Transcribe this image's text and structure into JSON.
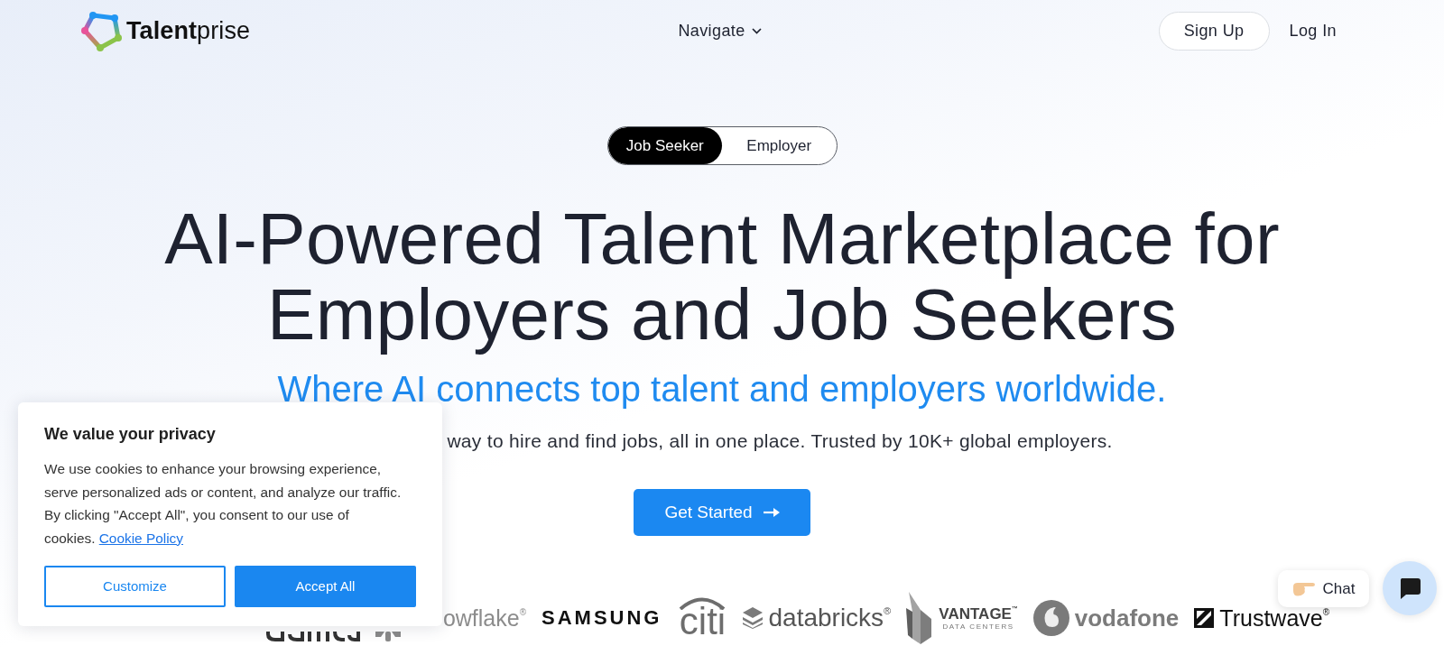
{
  "header": {
    "logo": {
      "text": "**Talent**prise"
    },
    "nav": [
      {
        "label": "Navigate",
        "kind": "dropdown"
      }
    ],
    "actions": [
      {
        "label": "Sign Up",
        "kind": "outline"
      },
      {
        "label": "Log In",
        "kind": "text"
      }
    ]
  },
  "audience_toggle": [
    {
      "label": "Job Seeker",
      "selected": true
    },
    {
      "label": "Employer",
      "selected": false
    }
  ],
  "hero": {
    "title": "AI-Powered Talent Marketplace for Employers and Job Seekers",
    "subtitle": "Where AI connects top talent and employers worldwide.",
    "description": "way to hire and find jobs, all in one place. Trusted by 10K+ global employers.",
    "cta": "Get Started"
  },
  "logos": [
    {
      "kind": "plain",
      "text": "owflake$^{®}$"
    },
    {
      "kind": "wide",
      "text": "SAMSUNG"
    },
    {
      "kind": "arc",
      "text": "citi"
    },
    {
      "kind": "stack",
      "text": "databricks$^{®}$"
    },
    {
      "kind": "tower",
      "text": "VANTAGE$^{™}$",
      "tagline": "DATA CENTERS"
    },
    {
      "kind": "drop",
      "text": "vodafone"
    },
    {
      "kind": "square",
      "text": "Trustwave$^{®}$"
    }
  ],
  "cookie_banner": {
    "title": "We value your privacy",
    "text": "We use cookies to enhance your browsing experience, serve personalized ads or content, and analyze our traffic. By clicking \"Accept All\", you consent to our use of cookies.",
    "link": "Cookie Policy",
    "buttons": [
      {
        "label": "Customize",
        "kind": "outline"
      },
      {
        "label": "Accept All",
        "kind": "primary"
      }
    ]
  },
  "chat": {
    "label": "Chat"
  }
}
